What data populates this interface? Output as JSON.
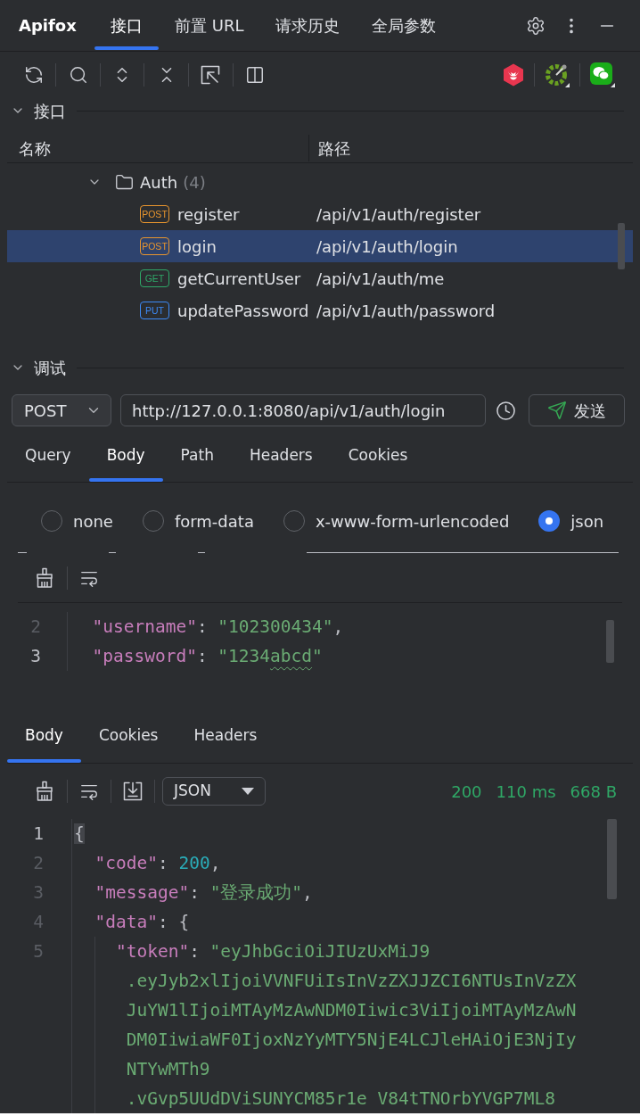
{
  "app": {
    "name": "Apifox"
  },
  "nav_tabs": [
    {
      "label": "接口",
      "selected": true
    },
    {
      "label": "前置 URL",
      "selected": false
    },
    {
      "label": "请求历史",
      "selected": false
    },
    {
      "label": "全局参数",
      "selected": false
    }
  ],
  "interfaces": {
    "title": "接口",
    "expanded": true,
    "columns": [
      "名称",
      "路径"
    ],
    "tree": [
      {
        "name": "Auth",
        "count": "(4)",
        "expanded": true,
        "children": [
          {
            "method": "POST",
            "color": "#e8952e",
            "name": "register",
            "path": "/api/v1/auth/register",
            "selected": false
          },
          {
            "method": "POST",
            "color": "#e8952e",
            "name": "login",
            "path": "/api/v1/auth/login",
            "selected": true
          },
          {
            "method": "GET",
            "color": "#2ea868",
            "name": "getCurrentUser",
            "path": "/api/v1/auth/me",
            "selected": false
          },
          {
            "method": "PUT",
            "color": "#3d8af7",
            "name": "updatePassword",
            "path": "/api/v1/auth/password",
            "selected": false
          }
        ]
      }
    ]
  },
  "debug": {
    "title": "调试",
    "expanded": true,
    "method": "POST",
    "url": "http://127.0.0.1:8080/api/v1/auth/login",
    "send_label": "发送",
    "tabs": [
      {
        "label": "Query",
        "selected": false
      },
      {
        "label": "Body",
        "selected": true
      },
      {
        "label": "Path",
        "selected": false
      },
      {
        "label": "Headers",
        "selected": false
      },
      {
        "label": "Cookies",
        "selected": false
      }
    ],
    "body_types": [
      {
        "label": "none",
        "selected": false
      },
      {
        "label": "form-data",
        "selected": false
      },
      {
        "label": "x-www-form-urlencoded",
        "selected": false
      },
      {
        "label": "json",
        "selected": true
      }
    ],
    "editor": {
      "lines": [
        {
          "children": [
            {
              "number": "2",
              "current": false,
              "parts": [
                {
                  "kind": "key",
                  "text": "\"username\""
                },
                {
                  "kind": "punct",
                  "text": ": "
                },
                {
                  "kind": "string",
                  "text": "\"102300434\""
                },
                {
                  "kind": "punct",
                  "text": ","
                }
              ]
            },
            {
              "number": "3",
              "current": true,
              "parts": [
                {
                  "kind": "key",
                  "text": "\"password\""
                },
                {
                  "kind": "punct",
                  "text": ": "
                },
                {
                  "kind": "string",
                  "text": "\"1234"
                },
                {
                  "kind": "misspelled_string",
                  "text": "abcd"
                },
                {
                  "kind": "string",
                  "text": "\""
                }
              ]
            }
          ]
        }
      ]
    }
  },
  "response": {
    "tabs": [
      {
        "label": "Body",
        "selected": true
      },
      {
        "label": "Cookies",
        "selected": false
      },
      {
        "label": "Headers",
        "selected": false
      }
    ],
    "format": "JSON",
    "status": "200",
    "time": "110 ms",
    "size": "668 B",
    "lines": [
      {
        "number": "1",
        "current": true,
        "parts": [
          {
            "kind": "matched_brace",
            "text": "{"
          }
        ],
        "children": [
          {
            "number": "2",
            "current": false,
            "parts": [
              {
                "kind": "key",
                "text": "\"code\""
              },
              {
                "kind": "punct",
                "text": ": "
              },
              {
                "kind": "number",
                "text": "200"
              },
              {
                "kind": "punct",
                "text": ","
              }
            ]
          },
          {
            "number": "3",
            "current": false,
            "parts": [
              {
                "kind": "key",
                "text": "\"message\""
              },
              {
                "kind": "punct",
                "text": ": "
              },
              {
                "kind": "string",
                "text": "\"登录成功\""
              },
              {
                "kind": "punct",
                "text": ","
              }
            ]
          },
          {
            "number": "4",
            "current": false,
            "parts": [
              {
                "kind": "key",
                "text": "\"data\""
              },
              {
                "kind": "punct",
                "text": ": {"
              }
            ],
            "children": [
              {
                "number": "5",
                "current": false,
                "parts": [
                  {
                    "kind": "key",
                    "text": "\"token\""
                  },
                  {
                    "kind": "punct",
                    "text": ": "
                  },
                  {
                    "kind": "string",
                    "text": "\"eyJhbGciOiJIUzUxMiJ9"
                  }
                ],
                "wrapped": [
                  ".eyJyb2xlIjoiVVNFUiIsInVzZXJJZCI6NTUsInVzZX",
                  "JuYW1lIjoiMTAyMzAwNDM0Iiwic3ViIjoiMTAyMzAwN",
                  "DM0IiwiaWF0IjoxNzYyMTY5NjE4LCJleHAiOjE3NjIy",
                  "NTYwMTh9",
                  ".vGvp5UUdDViSUNYCM85r1e V84tTNOrbYVGP7ML8"
                ]
              }
            ]
          }
        ]
      }
    ]
  }
}
